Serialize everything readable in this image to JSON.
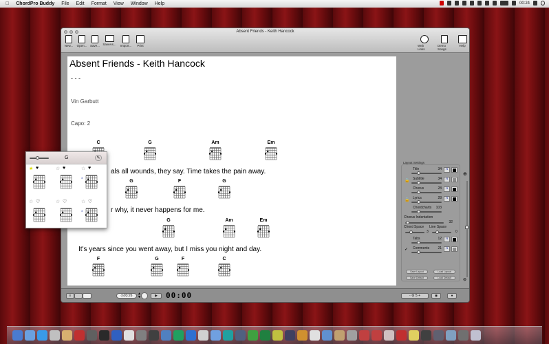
{
  "menubar": {
    "app": "ChordPro Buddy",
    "items": [
      "File",
      "Edit",
      "Format",
      "View",
      "Window",
      "Help"
    ],
    "clock": "00:24"
  },
  "window": {
    "title": "Absent Friends - Keith Hancock",
    "toolbar": [
      "New...",
      "Open...",
      "Save...",
      "SaveAs...",
      "Import...",
      "Print"
    ],
    "toolbar_right": [
      "Web Links",
      "Demo Songs",
      "Help"
    ]
  },
  "song": {
    "title": "Absent Friends - Keith Hancock",
    "subtitle": "- - -",
    "artist": "Vin Garbutt",
    "capo": "Capo:  2",
    "rows": [
      {
        "chords": [
          "C",
          "G",
          "Am",
          "Em"
        ],
        "lyric": "als all wounds, they say. Time takes the pain away."
      },
      {
        "chords": [
          "G",
          "F",
          "G"
        ],
        "lyric": "r why, it never happens for me."
      },
      {
        "chords": [
          "G",
          "Am",
          "Em"
        ],
        "lyric": "It's years since you went away, but I miss you night and day."
      },
      {
        "chords": [
          "F",
          "G",
          "F",
          "C"
        ],
        "lyric": ""
      }
    ]
  },
  "layout": {
    "heading": "Layout Settings",
    "title": {
      "label": "Title",
      "value": "34"
    },
    "subtitle": {
      "label": "Subtitle",
      "value": "34"
    },
    "chorus": {
      "label": "Chorus",
      "value": "28"
    },
    "lyrics": {
      "label": "Lyrics",
      "value": "28"
    },
    "chordcharts": {
      "label": "Chordcharts",
      "value": "103"
    },
    "indent": {
      "label": "Chorus Indentation",
      "value": "32"
    },
    "chordspace": {
      "label": "Chord Space",
      "value": "3"
    },
    "linespace": {
      "label": "Line Space",
      "value": "0"
    },
    "tabs": {
      "label": "Tabs",
      "value": "12"
    },
    "comments": {
      "label": "Comments",
      "value": "21"
    },
    "font_btn": "A",
    "buttons": [
      "Save Layout",
      "Load Layout",
      "Save Default",
      "Load Default"
    ]
  },
  "bottom": {
    "duration": "03:26",
    "timer": "00:00",
    "transpose": "5",
    "minus": "-",
    "plus": "+"
  },
  "popover": {
    "chord": "G",
    "fret_label": "3"
  },
  "colors": {
    "accent": "#3344aa",
    "background": "#7a1012"
  }
}
